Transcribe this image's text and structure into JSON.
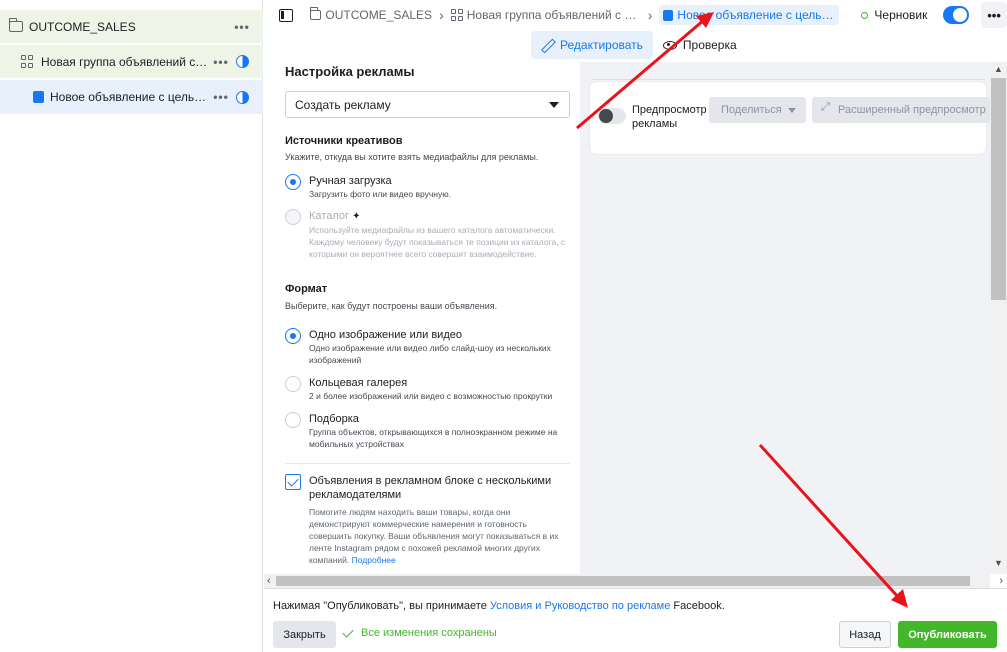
{
  "sidebar": {
    "items": [
      {
        "label": "OUTCOME_SALES",
        "icon": "folder-icon"
      },
      {
        "label": "Новая группа объявлений с целью...",
        "icon": "ad-set-grid-icon"
      },
      {
        "label": "Новое объявление с целью \"Про...",
        "icon": "ad-icon"
      }
    ],
    "more_label": "•••"
  },
  "topbar": {
    "breadcrumbs": [
      {
        "label": "OUTCOME_SALES"
      },
      {
        "label": "Новая группа объявлений с целью"
      },
      {
        "label": "Новое объявление с целью \"Прод"
      }
    ],
    "status_label": "Черновик",
    "toggle_on": true,
    "more_label": "•••"
  },
  "modes": {
    "edit_label": "Редактировать",
    "review_label": "Проверка"
  },
  "editor": {
    "title": "Настройка рекламы",
    "select_value": "Создать рекламу",
    "sources": {
      "heading": "Источники креативов",
      "hint": "Укажите, откуда вы хотите взять медиафайлы для рекламы.",
      "manual_title": "Ручная загрузка",
      "manual_desc": "Загрузить фото или видео вручную.",
      "catalog_title": "Каталог",
      "catalog_desc": "Используйте медиафайлы из вашего каталога автоматически. Каждому человеку будут показываться те позиции из каталога, с которыми он вероятнее всего совершит взаимодействие."
    },
    "format": {
      "heading": "Формат",
      "hint": "Выберите, как будут построены ваши объявления.",
      "single_title": "Одно изображение или видео",
      "single_desc": "Одно изображение или видео либо слайд-шоу из нескольких изображений",
      "carousel_title": "Кольцевая галерея",
      "carousel_desc": "2 и более изображений или видео с возможностью прокрутки",
      "collection_title": "Подборка",
      "collection_desc": "Группа объектов, открывающихся в полноэкранном режиме на мобильных устройствах"
    },
    "multi_advertiser": {
      "title": "Объявления в рекламном блоке с несколькими рекламодателями",
      "desc": "Помогите людям находить ваши товары, когда они демонстрируют коммерческие намерения и готовность совершить покупку. Ваши объявления могут показываться в их ленте Instagram рядом с похожей рекламой многих других компаний.",
      "link": "Подробнее",
      "checked": true
    }
  },
  "preview": {
    "toggle_label": "Предпросмотр рекламы",
    "share_label": "Поделиться",
    "advanced_label": "Расширенный предпросмотр"
  },
  "footer": {
    "terms_prefix": "Нажимая \"Опубликовать\", вы принимаете ",
    "terms_link": "Условия и Руководство по рекламе",
    "terms_suffix": " Facebook.",
    "close_label": "Закрыть",
    "saved_label": "Все изменения сохранены",
    "back_label": "Назад",
    "publish_label": "Опубликовать"
  },
  "colors": {
    "accent": "#1877f2",
    "publish_green": "#42b72a",
    "annotation_red": "#e8141a"
  }
}
